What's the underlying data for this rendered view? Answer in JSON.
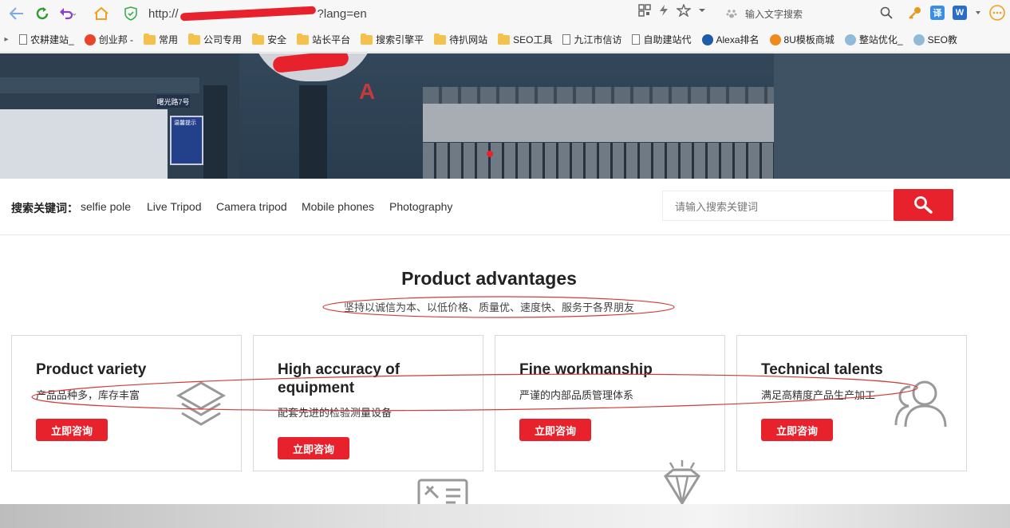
{
  "browser": {
    "url_prefix": "http://",
    "url_suffix": "?lang=en",
    "search_placeholder": "输入文字搜索",
    "ext_translate": "译",
    "ext_word": "W",
    "bookmarks": [
      {
        "label": "农耕建站_",
        "icon": "page"
      },
      {
        "label": "创业邦 -",
        "icon": "brand"
      },
      {
        "label": "常用",
        "icon": "folder"
      },
      {
        "label": "公司专用",
        "icon": "folder"
      },
      {
        "label": "安全",
        "icon": "folder"
      },
      {
        "label": "站长平台",
        "icon": "folder"
      },
      {
        "label": "搜索引擎平",
        "icon": "folder"
      },
      {
        "label": "待扒网站",
        "icon": "folder"
      },
      {
        "label": "SEO工具",
        "icon": "folder"
      },
      {
        "label": "九江市信访",
        "icon": "page"
      },
      {
        "label": "自助建站代",
        "icon": "page"
      },
      {
        "label": "Alexa排名",
        "icon": "alexa"
      },
      {
        "label": "8U模板商城",
        "icon": "brand-u"
      },
      {
        "label": "整站优化_",
        "icon": "cloud"
      },
      {
        "label": "SEO教",
        "icon": "cloud"
      }
    ]
  },
  "banner": {
    "sign_text": "曙光路7号",
    "notice_text": "温馨提示",
    "letter": "A"
  },
  "search": {
    "label": "搜索关键词：",
    "keywords": [
      "selfie pole",
      "Live Tripod",
      "Camera tripod",
      "Mobile phones",
      "Photography"
    ],
    "placeholder": "请输入搜索关键词"
  },
  "section": {
    "title": "Product advantages",
    "subtitle": "坚持以诚信为本、以低价格、质量优、速度快、服务于各界朋友"
  },
  "cards": [
    {
      "title": "Product variety",
      "desc": "产品品种多，库存丰富",
      "button": "立即咨询",
      "icon": "layers-icon"
    },
    {
      "title": "High accuracy of equipment",
      "desc": "配套先进的检验测量设备",
      "button": "立即咨询",
      "icon": "tools-icon"
    },
    {
      "title": "Fine workmanship",
      "desc": "严谨的内部品质管理体系",
      "button": "立即咨询",
      "icon": "diamond-icon"
    },
    {
      "title": "Technical talents",
      "desc": "满足高精度产品生产加工",
      "button": "立即咨询",
      "icon": "users-icon"
    }
  ],
  "colors": {
    "accent": "#e8222c",
    "annotation": "#d33a3a"
  }
}
